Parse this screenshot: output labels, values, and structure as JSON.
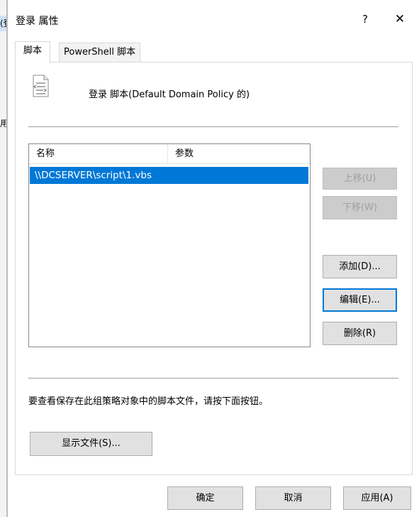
{
  "background_fragments": {
    "top": "(登",
    "side": "用户"
  },
  "dialog": {
    "title": "登录 属性",
    "help_label": "?",
    "close_label": "✕"
  },
  "tabs": [
    {
      "label": "脚本",
      "active": true
    },
    {
      "label": "PowerShell 脚本",
      "active": false
    }
  ],
  "header": {
    "text": "登录 脚本(Default Domain Policy 的)"
  },
  "list": {
    "columns": [
      "名称",
      "参数"
    ],
    "rows": [
      {
        "name": "\\\\DCSERVER\\script\\1.vbs",
        "params": "",
        "selected": true
      }
    ]
  },
  "buttons": {
    "move_up": "上移(U)",
    "move_down": "下移(W)",
    "add": "添加(D)...",
    "edit": "编辑(E)...",
    "delete": "删除(R)"
  },
  "info_text": "要查看保存在此组策略对象中的脚本文件，请按下面按钮。",
  "show_files": "显示文件(S)...",
  "footer": {
    "ok": "确定",
    "cancel": "取消",
    "apply": "应用(A)"
  },
  "colors": {
    "selection": "#0078d7",
    "focus_border": "#0078d7",
    "button_bg": "#e1e1e1"
  },
  "icons": {
    "dialog": "script-file-icon"
  }
}
